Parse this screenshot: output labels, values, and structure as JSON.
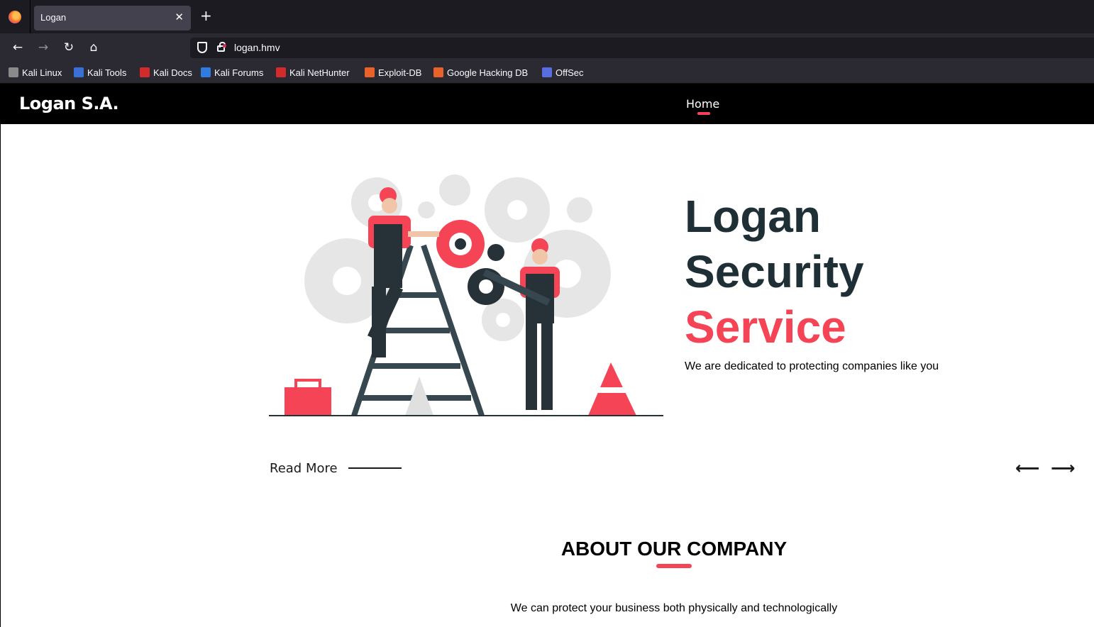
{
  "browser": {
    "tab_title": "Logan",
    "tab_close": "✕",
    "new_tab": "+",
    "url": "logan.hmv",
    "nav": {
      "back": "←",
      "forward": "→",
      "reload": "↻",
      "home": "⌂"
    },
    "bookmarks": [
      {
        "label": "Kali Linux",
        "icon_color": "#8a8a8a"
      },
      {
        "label": "Kali Tools",
        "icon_color": "#3a6fd8"
      },
      {
        "label": "Kali Docs",
        "icon_color": "#d32b2b"
      },
      {
        "label": "Kali Forums",
        "icon_color": "#2f7be0"
      },
      {
        "label": "Kali NetHunter",
        "icon_color": "#d32b2b"
      },
      {
        "label": "Exploit-DB",
        "icon_color": "#e8622a"
      },
      {
        "label": "Google Hacking DB",
        "icon_color": "#e8622a"
      },
      {
        "label": "OffSec",
        "icon_color": "#5a6de0"
      }
    ]
  },
  "site": {
    "brand": "Logan S.A.",
    "nav_home": "Home",
    "hero": {
      "title_line1": "Logan",
      "title_line2": "Security",
      "title_accent": "Service",
      "subtitle": "We are dedicated to protecting companies like you"
    },
    "read_more": "Read More",
    "arrow_prev": "⟵",
    "arrow_next": "⟶",
    "about": {
      "title": "ABOUT OUR COMPANY",
      "text": "We can protect your business both physically and technologically"
    },
    "colors": {
      "accent": "#f54455",
      "dark": "#1f2f36",
      "header_bg": "#000000"
    }
  }
}
